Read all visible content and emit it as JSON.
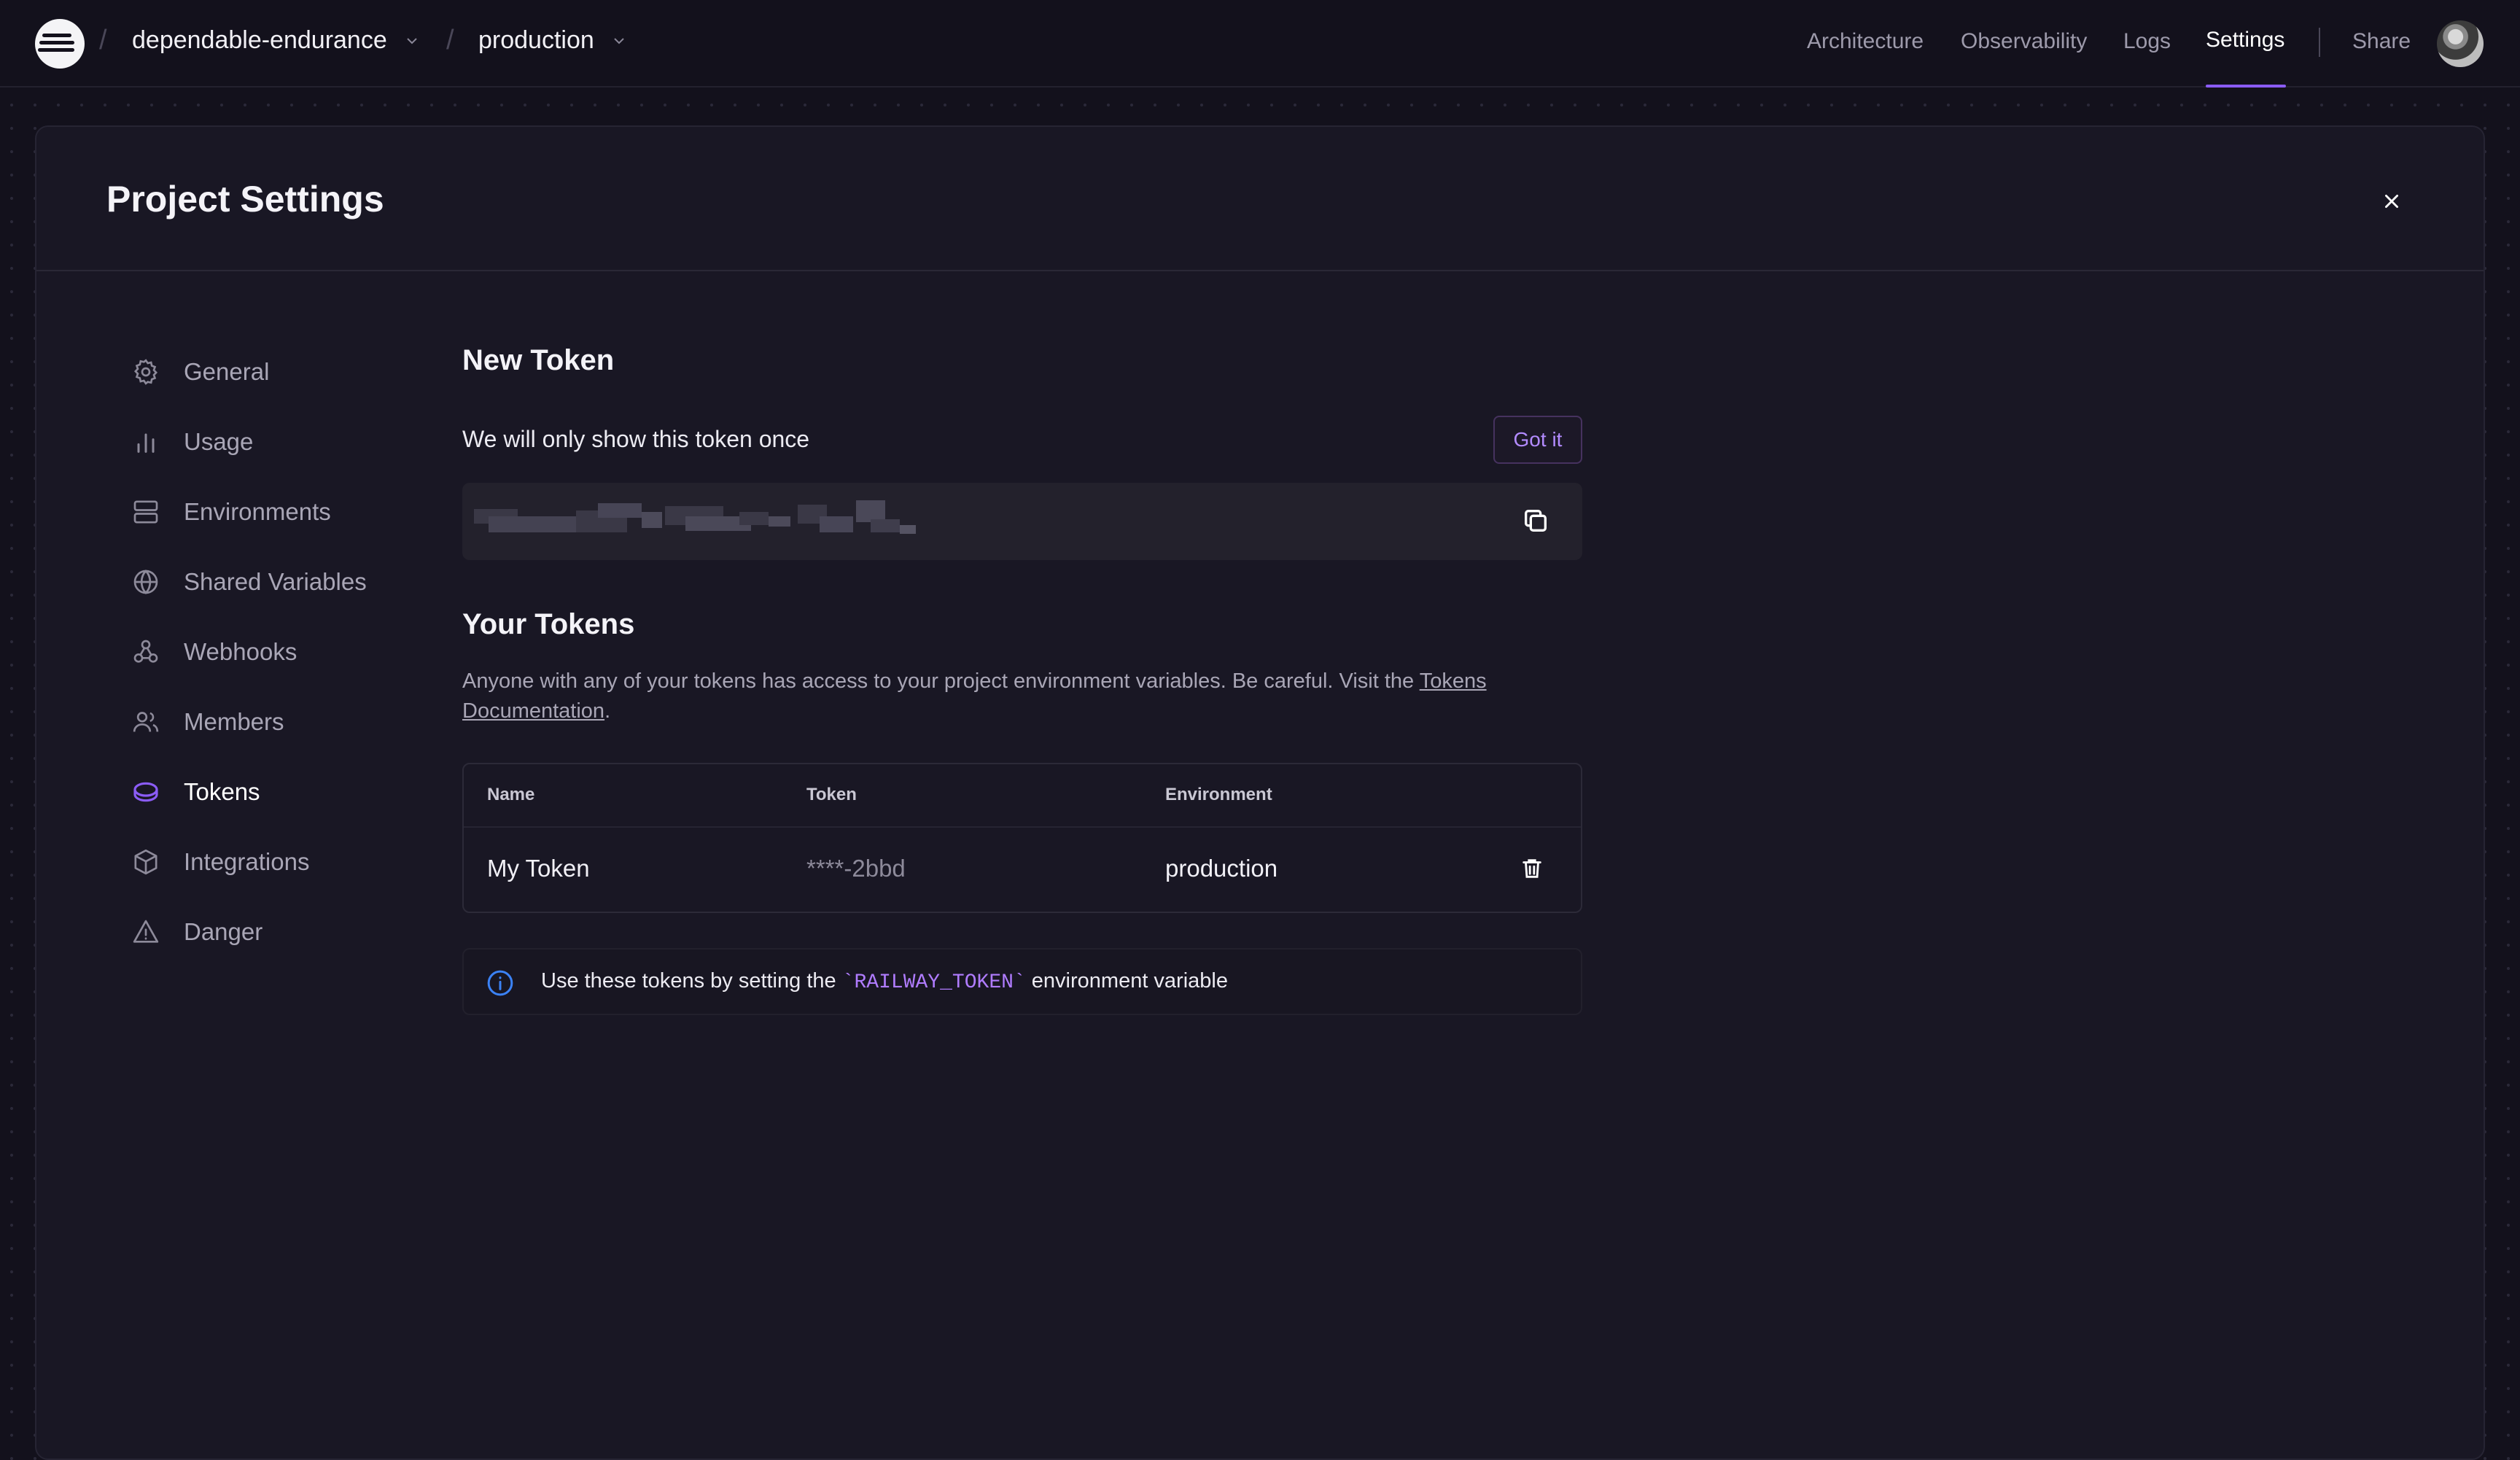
{
  "topbar": {
    "project": "dependable-endurance",
    "environment": "production",
    "nav": [
      "Architecture",
      "Observability",
      "Logs",
      "Settings"
    ],
    "active_nav": "Settings",
    "share": "Share"
  },
  "modal": {
    "title": "Project Settings"
  },
  "sidebar": {
    "items": [
      {
        "label": "General",
        "icon": "gear-icon"
      },
      {
        "label": "Usage",
        "icon": "bar-chart-icon"
      },
      {
        "label": "Environments",
        "icon": "server-icon"
      },
      {
        "label": "Shared Variables",
        "icon": "globe-icon"
      },
      {
        "label": "Webhooks",
        "icon": "webhook-icon"
      },
      {
        "label": "Members",
        "icon": "users-icon"
      },
      {
        "label": "Tokens",
        "icon": "token-icon"
      },
      {
        "label": "Integrations",
        "icon": "box-icon"
      },
      {
        "label": "Danger",
        "icon": "warning-icon"
      }
    ],
    "active": "Tokens"
  },
  "new_token": {
    "heading": "New Token",
    "notice": "We will only show this token once",
    "got_it": "Got it"
  },
  "your_tokens": {
    "heading": "Your Tokens",
    "description": "Anyone with any of your tokens has access to your project environment variables. Be careful. Visit the ",
    "link_text": "Tokens Documentation",
    "description_end": ".",
    "columns": [
      "Name",
      "Token",
      "Environment"
    ],
    "rows": [
      {
        "name": "My Token",
        "token": "****-2bbd",
        "environment": "production"
      }
    ]
  },
  "info": {
    "prefix": "Use these tokens by setting the ",
    "code": "`RAILWAY_TOKEN`",
    "suffix": " environment variable"
  },
  "colors": {
    "accent": "#8b5cf6",
    "info_icon": "#3b82f6",
    "code": "#b07cff"
  }
}
